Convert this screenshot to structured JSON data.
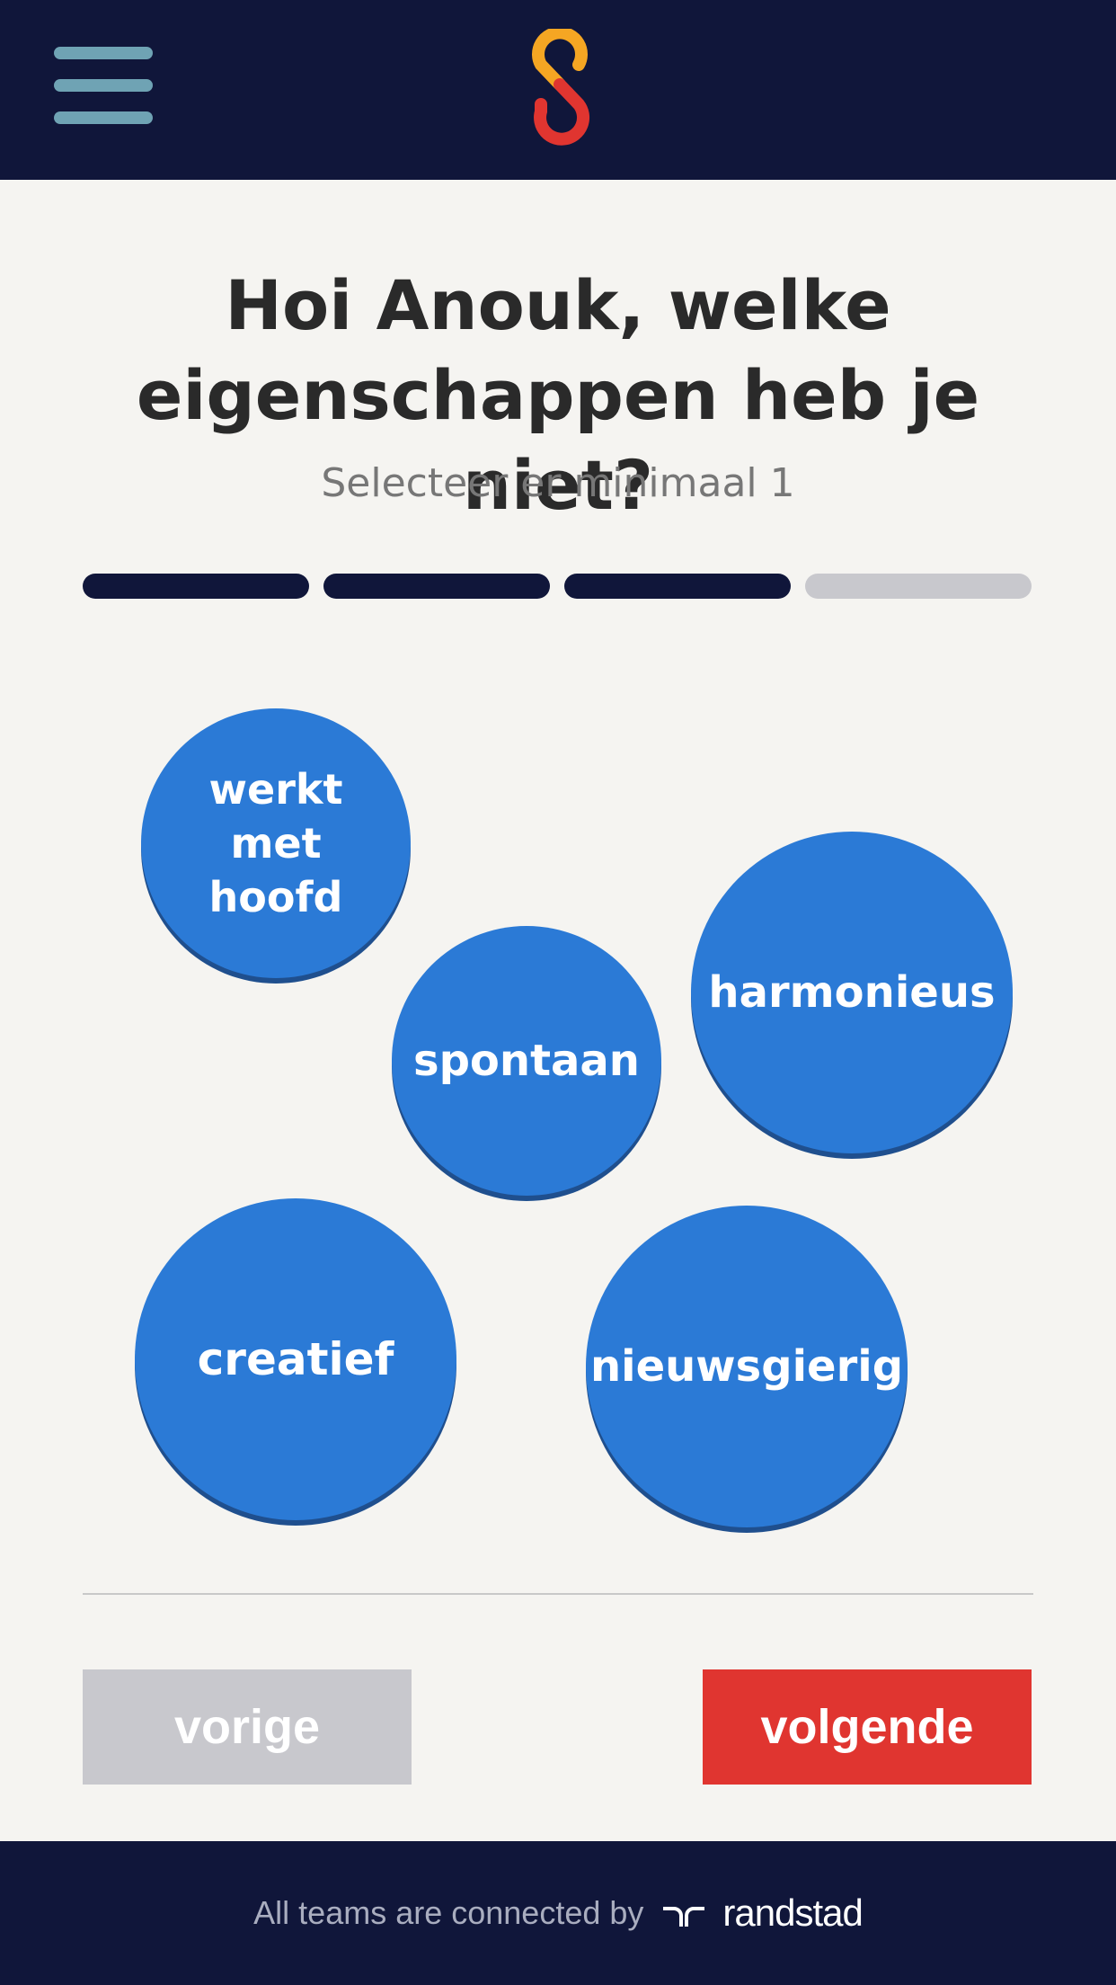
{
  "header": {
    "menu_icon": "hamburger-menu-icon",
    "logo": "s-logo",
    "logo_colors": [
      "#f5a623",
      "#e03530"
    ]
  },
  "question": {
    "title_line1": "Hoi Anouk, welke",
    "title_line2": "eigenschappen heb je niet?",
    "subtitle": "Selecteer er minimaal 1"
  },
  "progress": {
    "total_steps": 4,
    "completed_steps": 3
  },
  "traits": {
    "hoofd": [
      "werkt",
      "met",
      "hoofd"
    ],
    "spontaan": "spontaan",
    "harmonieus": "harmonieus",
    "creatief": "creatief",
    "nieuwsgierig": "nieuwsgierig"
  },
  "nav": {
    "prev_label": "vorige",
    "next_label": "volgende"
  },
  "footer": {
    "text": "All teams are connected by",
    "brand": "randstad",
    "brand_icon": "randstad-logo-icon"
  },
  "colors": {
    "navy": "#10163a",
    "bubble_blue": "#2b7ad6",
    "next_red": "#e03530",
    "inactive_grey": "#c8c8cd"
  }
}
